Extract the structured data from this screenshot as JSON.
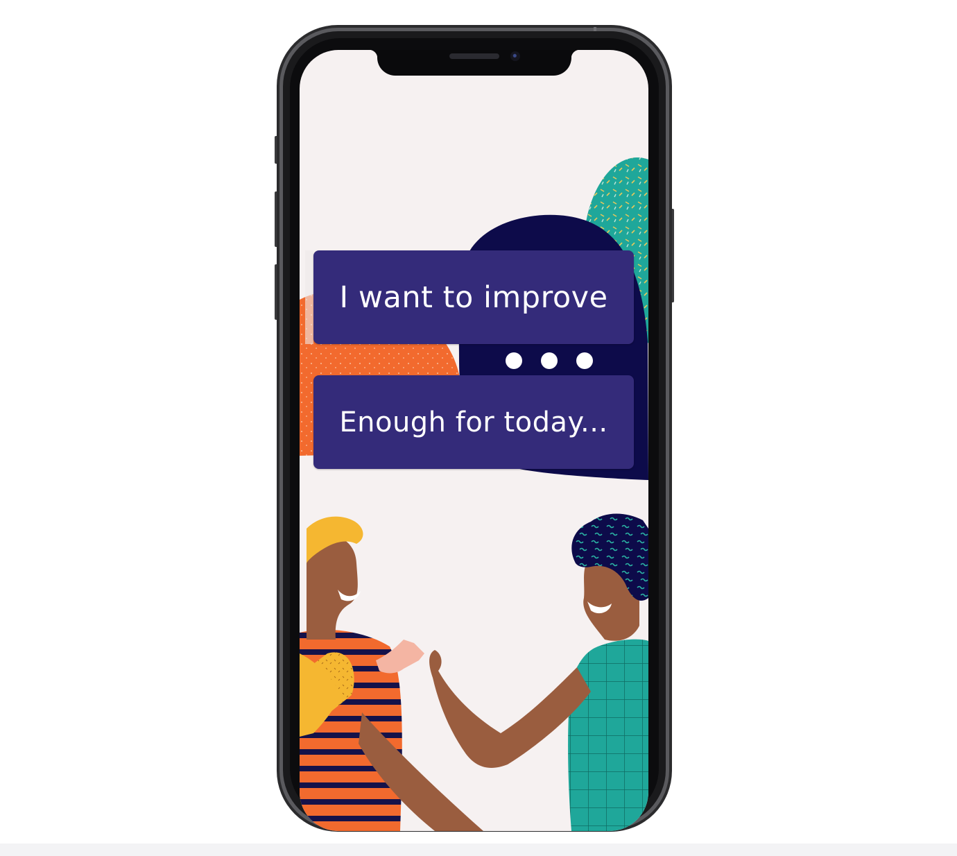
{
  "screen": {
    "primary_prompt": "I want to improve",
    "secondary_prompt": "Enough for today..."
  },
  "colors": {
    "button_bg": "#342b7a",
    "button_text": "#ffffff",
    "screen_bg": "#f6f1f1",
    "navy_bubble": "#0d0b4a",
    "orange_bubble": "#f26a2e",
    "teal_bubble": "#1fa79a",
    "frame": "#1c1c1e"
  },
  "illustration": {
    "description_icon": "two-people-talking-illustration",
    "typing_indicator_icon": "typing-dots-icon"
  }
}
